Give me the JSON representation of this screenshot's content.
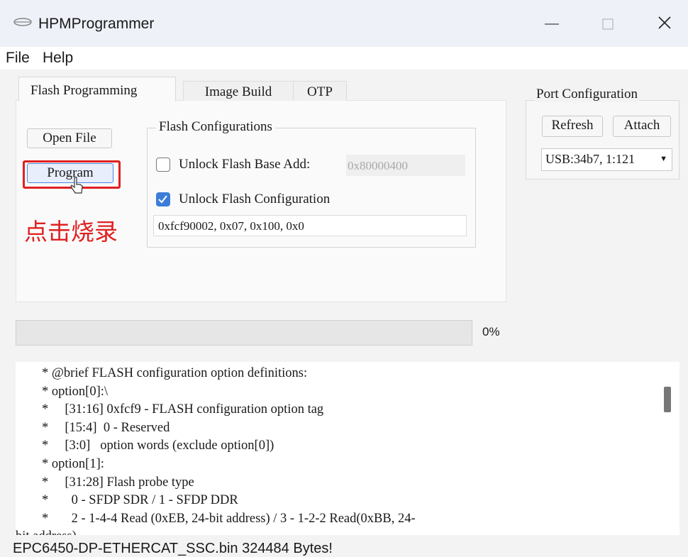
{
  "window": {
    "title": "HPMProgrammer"
  },
  "menu": [
    "File",
    "Help"
  ],
  "tabs": [
    {
      "label": "Flash Programming",
      "active": true
    },
    {
      "label": "Image Build",
      "active": false
    },
    {
      "label": "OTP",
      "active": false
    }
  ],
  "buttons": {
    "open_file": "Open File",
    "program": "Program"
  },
  "annotation": "点击烧录",
  "flash_config": {
    "title": "Flash Configurations",
    "unlock_base_label": "Unlock Flash Base Add:",
    "unlock_base_checked": false,
    "base_address": "0x80000400",
    "unlock_config_label": "Unlock Flash Configuration",
    "unlock_config_checked": true,
    "config_value": "0xfcf90002, 0x07, 0x100, 0x0"
  },
  "progress": {
    "percent": 0,
    "label": "0%"
  },
  "port": {
    "title": "Port Configuration",
    "refresh": "Refresh",
    "attach": "Attach",
    "selected": "USB:34b7, 1:121"
  },
  "log_lines": [
    "        * @brief FLASH configuration option definitions:",
    "        * option[0]:\\",
    "        *     [31:16] 0xfcf9 - FLASH configuration option tag",
    "        *     [15:4]  0 - Reserved",
    "        *     [3:0]   option words (exclude option[0])",
    "        * option[1]:",
    "        *     [31:28] Flash probe type",
    "        *       0 - SFDP SDR / 1 - SFDP DDR",
    "        *       2 - 1-4-4 Read (0xEB, 24-bit address) / 3 - 1-2-2 Read(0xBB, 24-",
    "bit address)"
  ],
  "status": "EPC6450-DP-ETHERCAT_SSC.bin 324484 Bytes!",
  "colors": {
    "accent": "#3c7dd9",
    "annotation": "#e02020"
  }
}
